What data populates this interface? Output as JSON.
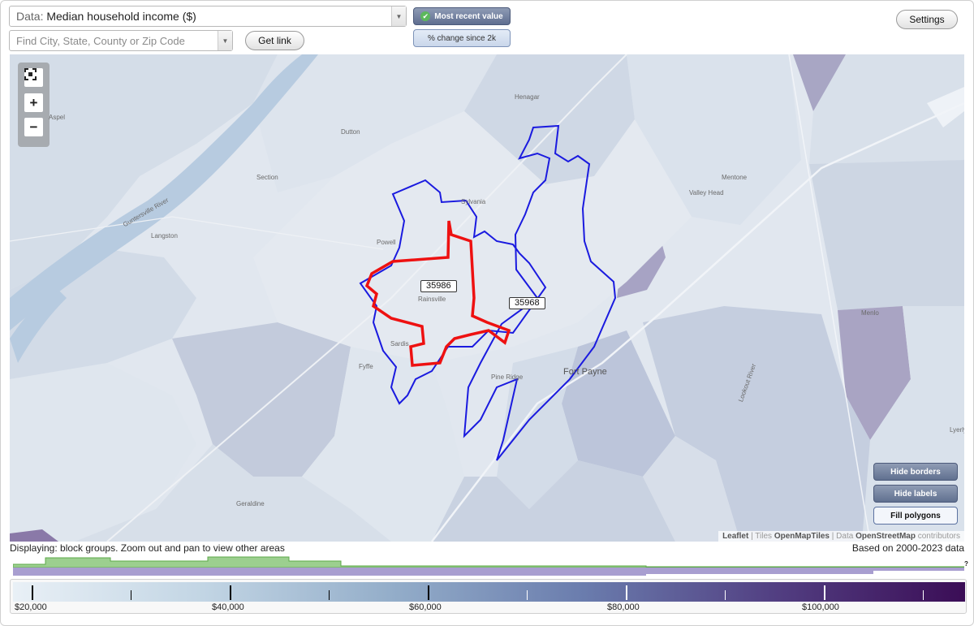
{
  "controls": {
    "data_label": "Data:",
    "data_value": "Median household income ($)",
    "search_placeholder": "Find City, State, County or Zip Code",
    "get_link": "Get link",
    "most_recent": "Most recent value",
    "pct_change": "% change since 2k",
    "settings": "Settings"
  },
  "map": {
    "places": [
      "Henagar",
      "Aspel",
      "Dutton",
      "Section",
      "Sylvania",
      "Mentone",
      "Valley Head",
      "Langston",
      "Powell",
      "Rainsville",
      "Fort Payne",
      "Pine Ridge",
      "Fyffe",
      "Menlo",
      "Geraldine",
      "Lyerly",
      "Sardis",
      "Lookout River",
      "Guntersville River"
    ],
    "zip_labels": [
      "35986",
      "35968"
    ],
    "buttons": {
      "hide_borders": "Hide borders",
      "hide_labels": "Hide labels",
      "fill_polygons": "Fill polygons"
    },
    "attribution": {
      "leaflet": "Leaflet",
      "tiles": "Tiles",
      "tiles_src": "OpenMapTiles",
      "data": "Data",
      "data_src": "OpenStreetMap",
      "contrib": "contributors"
    },
    "border_colors": {
      "selected": "#ee1111",
      "outline": "#1a1adf"
    }
  },
  "footer": {
    "displaying": "Displaying: block groups. Zoom out and pan to view other areas",
    "based_on": "Based on 2000-2023 data",
    "unknown_mark": "?"
  },
  "legend": {
    "labels": [
      "$20,000",
      "$40,000",
      "$60,000",
      "$80,000",
      "$100,000"
    ],
    "scale_min": 20000,
    "scale_max": 117000,
    "colors": [
      "#e9f0f6",
      "#c2d5e4",
      "#93adc9",
      "#6a7cad",
      "#523f82",
      "#3b0d56"
    ]
  }
}
